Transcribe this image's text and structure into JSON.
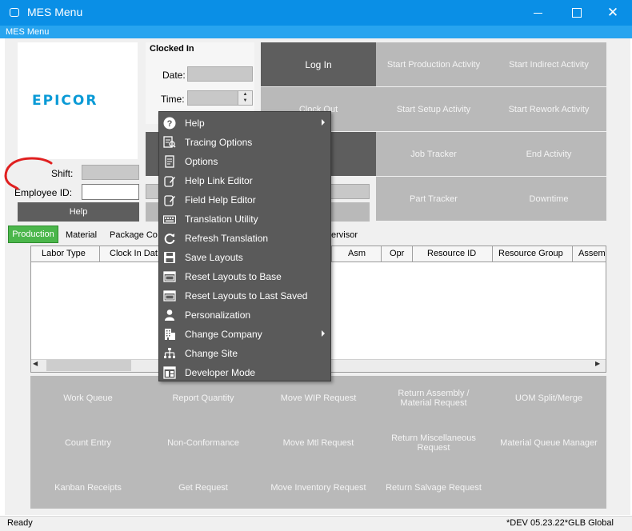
{
  "window": {
    "title": "MES Menu"
  },
  "subbar": {
    "label": "MES Menu"
  },
  "logo": {
    "text": "EPICOR"
  },
  "clock": {
    "header": "Clocked In",
    "date_label": "Date:",
    "time_label": "Time:"
  },
  "actions": {
    "log_in": "Log In",
    "clock_out": "Clock Out",
    "start_production": "Start Production Activity",
    "start_indirect": "Start Indirect Activity",
    "start_setup": "Start Setup Activity",
    "start_rework": "Start Rework Activity",
    "job_tracker": "Job Tracker",
    "end_activity": "End Activity",
    "part_tracker": "Part Tracker",
    "downtime": "Downtime"
  },
  "employee": {
    "shift_label": "Shift:",
    "employee_id_label": "Employee ID:",
    "help_label": "Help"
  },
  "tabs": [
    "Production",
    "Material",
    "Package Co",
    "ervisor"
  ],
  "grid": {
    "columns": [
      "Labor Type",
      "Clock In Dat",
      "Asm",
      "Opr",
      "Resource ID",
      "Resource Group",
      "Assem"
    ]
  },
  "bottom_tiles": [
    [
      "Work Queue",
      "Report Quantity",
      "Move WIP Request",
      "Return Assembly / Material Request",
      "UOM Split/Merge"
    ],
    [
      "Count Entry",
      "Non-Conformance",
      "Move Mtl Request",
      "Return Miscellaneous Request",
      "Material Queue Manager"
    ],
    [
      "Kanban Receipts",
      "Get Request",
      "Move Inventory Request",
      "Return Salvage Request",
      ""
    ]
  ],
  "status": {
    "left": "Ready",
    "right": "*DEV 05.23.22*GLB Global"
  },
  "context_menu": {
    "items": [
      {
        "label": "Help",
        "icon": "help-icon",
        "submenu": true
      },
      {
        "label": "Tracing Options",
        "icon": "tracing-options-icon",
        "submenu": false
      },
      {
        "label": "Options",
        "icon": "options-icon",
        "submenu": false
      },
      {
        "label": "Help Link Editor",
        "icon": "edit-icon",
        "submenu": false
      },
      {
        "label": "Field Help Editor",
        "icon": "edit-icon",
        "submenu": false
      },
      {
        "label": "Translation Utility",
        "icon": "keyboard-icon",
        "submenu": false
      },
      {
        "label": "Refresh Translation",
        "icon": "refresh-icon",
        "submenu": false
      },
      {
        "label": "Save Layouts",
        "icon": "save-icon",
        "submenu": false
      },
      {
        "label": "Reset Layouts to Base",
        "icon": "window-icon",
        "submenu": false
      },
      {
        "label": "Reset Layouts to Last Saved",
        "icon": "window-icon",
        "submenu": false
      },
      {
        "label": "Personalization",
        "icon": "person-icon",
        "submenu": false
      },
      {
        "label": "Change Company",
        "icon": "building-icon",
        "submenu": true
      },
      {
        "label": "Change Site",
        "icon": "sitemap-icon",
        "submenu": false
      },
      {
        "label": "Developer Mode",
        "icon": "developer-icon",
        "submenu": false
      }
    ]
  },
  "colors": {
    "titlebar": "#0a8fe6",
    "subbar": "#27a4ef",
    "tab_active": "#4bb64b",
    "menu_bg": "#5a5a5a",
    "annotation": "#e02020",
    "logo": "#0a9ad6"
  }
}
